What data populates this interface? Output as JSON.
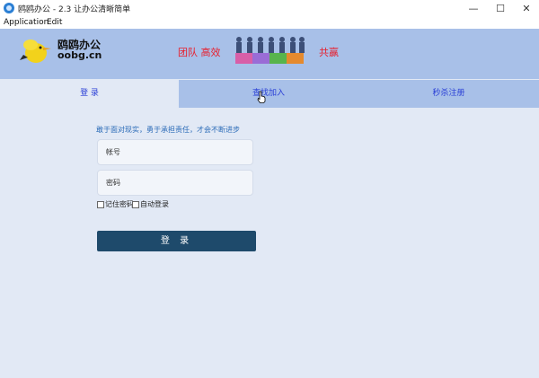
{
  "window": {
    "title": "鸥鸥办公 - 2.3 让办公清晰简单",
    "controls": {
      "minimize": "—",
      "maximize": "☐",
      "close": "✕"
    }
  },
  "menu": [
    "Application",
    "Edit"
  ],
  "banner": {
    "logo_name": "鸥鸥办公",
    "logo_domain": "oobg.cn",
    "slogan_left": "团队 高效",
    "slogan_right": "共赢"
  },
  "tabs": [
    {
      "label": "登 录",
      "active": true
    },
    {
      "label": "查找加入",
      "active": false
    },
    {
      "label": "秒杀注册",
      "active": false
    }
  ],
  "form": {
    "tip": "敢于面对现实，勇于承担责任，才会不断进步",
    "account_placeholder": "帐号",
    "password_placeholder": "密码",
    "remember_label": "记住密码",
    "autologin_label": "自动登录",
    "login_button": "登 录"
  },
  "colors": {
    "banner_bg": "#a8c0e8",
    "page_bg": "#e2e9f5",
    "slogan": "#e81e2c",
    "tab_text": "#2a3fd6",
    "button_bg": "#1e4a6b"
  }
}
